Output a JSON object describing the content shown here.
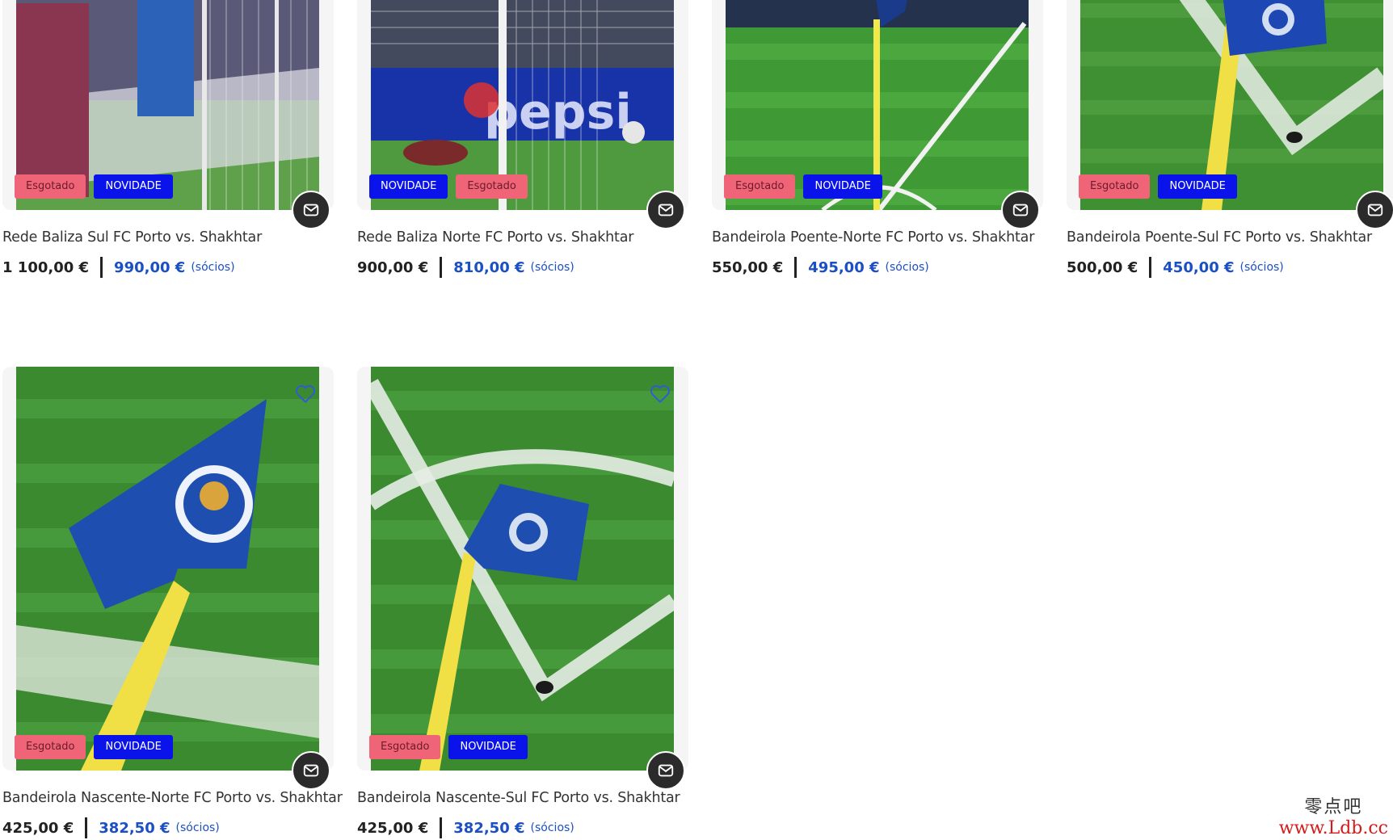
{
  "products": [
    {
      "title": "Rede Baliza Sul FC Porto vs. Shakhtar",
      "price": "1 100,00 €",
      "member_price": "990,00 €",
      "member_note": "(sócios)",
      "badges": [
        "Esgotado",
        "NOVIDADE"
      ],
      "image": "goal-net-south-icon"
    },
    {
      "title": "Rede Baliza Norte FC Porto vs. Shakhtar",
      "price": "900,00 €",
      "member_price": "810,00 €",
      "member_note": "(sócios)",
      "badges": [
        "NOVIDADE",
        "Esgotado"
      ],
      "image": "goal-net-north-icon"
    },
    {
      "title": "Bandeirola Poente-Norte FC Porto vs. Shakhtar",
      "price": "550,00 €",
      "member_price": "495,00 €",
      "member_note": "(sócios)",
      "badges": [
        "Esgotado",
        "NOVIDADE"
      ],
      "image": "corner-flag-stadium-icon"
    },
    {
      "title": "Bandeirola Poente-Sul FC Porto vs. Shakhtar",
      "price": "500,00 €",
      "member_price": "450,00 €",
      "member_note": "(sócios)",
      "badges": [
        "Esgotado",
        "NOVIDADE"
      ],
      "image": "corner-flag-grass-icon"
    },
    {
      "title": "Bandeirola Nascente-Norte FC Porto vs. Shakhtar",
      "price": "425,00 €",
      "member_price": "382,50 €",
      "member_note": "(sócios)",
      "badges": [
        "Esgotado",
        "NOVIDADE"
      ],
      "image": "corner-flag-closeup-icon"
    },
    {
      "title": "Bandeirola Nascente-Sul FC Porto vs. Shakhtar",
      "price": "425,00 €",
      "member_price": "382,50 €",
      "member_note": "(sócios)",
      "badges": [
        "Esgotado",
        "NOVIDADE"
      ],
      "image": "corner-flag-arc-icon"
    }
  ],
  "watermark": {
    "top": "零点吧",
    "bottom": "www.Ldb.cc"
  },
  "colors": {
    "sold_badge": "#f06478",
    "new_badge": "#0a14ea",
    "member_price": "#1b4fc4",
    "mail_button": "#2b2b2b"
  }
}
